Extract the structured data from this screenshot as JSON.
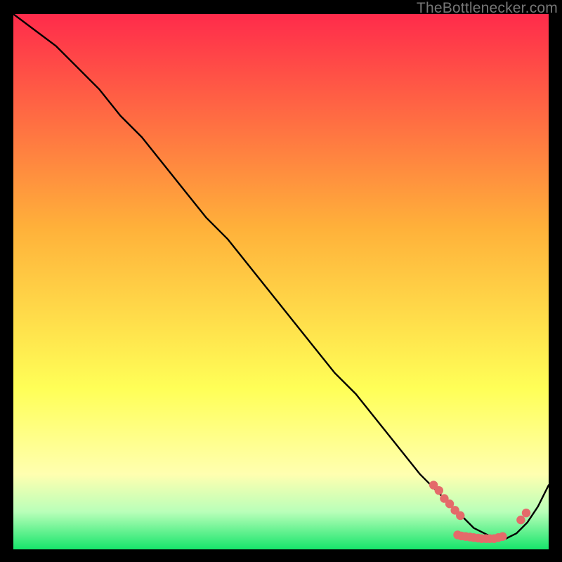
{
  "watermark": "TheBottlenecker.com",
  "colors": {
    "red": "#ff2b4b",
    "orange": "#ffb13a",
    "yellow": "#ffff57",
    "paleyellow": "#ffffb0",
    "green_light": "#b9ffb9",
    "green": "#16e56b",
    "black": "#000000",
    "marker": "#e46a6a"
  },
  "chart_data": {
    "type": "line",
    "title": "",
    "xlabel": "",
    "ylabel": "",
    "xlim": [
      0,
      100
    ],
    "ylim": [
      0,
      100
    ],
    "grid": false,
    "legend": false,
    "series": [
      {
        "name": "curve",
        "x": [
          0,
          4,
          8,
          12,
          16,
          20,
          24,
          28,
          32,
          36,
          40,
          44,
          48,
          52,
          56,
          60,
          64,
          68,
          72,
          76,
          80,
          82,
          84,
          86,
          88,
          90,
          92,
          94,
          96,
          98,
          100
        ],
        "y": [
          100,
          97,
          94,
          90,
          86,
          81,
          77,
          72,
          67,
          62,
          58,
          53,
          48,
          43,
          38,
          33,
          29,
          24,
          19,
          14,
          10,
          8,
          6,
          4,
          3,
          2,
          2,
          3,
          5,
          8,
          12
        ]
      }
    ],
    "markers": [
      {
        "x": 78.5,
        "y": 12.0
      },
      {
        "x": 79.5,
        "y": 11.0
      },
      {
        "x": 80.5,
        "y": 9.5
      },
      {
        "x": 81.5,
        "y": 8.5
      },
      {
        "x": 82.5,
        "y": 7.3
      },
      {
        "x": 83.5,
        "y": 6.3
      },
      {
        "x": 83.0,
        "y": 2.7
      },
      {
        "x": 83.7,
        "y": 2.5
      },
      {
        "x": 84.5,
        "y": 2.4
      },
      {
        "x": 85.3,
        "y": 2.3
      },
      {
        "x": 86.0,
        "y": 2.2
      },
      {
        "x": 86.8,
        "y": 2.1
      },
      {
        "x": 87.5,
        "y": 2.0
      },
      {
        "x": 88.3,
        "y": 2.0
      },
      {
        "x": 89.0,
        "y": 2.0
      },
      {
        "x": 89.8,
        "y": 2.0
      },
      {
        "x": 90.6,
        "y": 2.2
      },
      {
        "x": 91.4,
        "y": 2.4
      },
      {
        "x": 94.8,
        "y": 5.5
      },
      {
        "x": 95.8,
        "y": 6.8
      }
    ],
    "annotations": []
  }
}
